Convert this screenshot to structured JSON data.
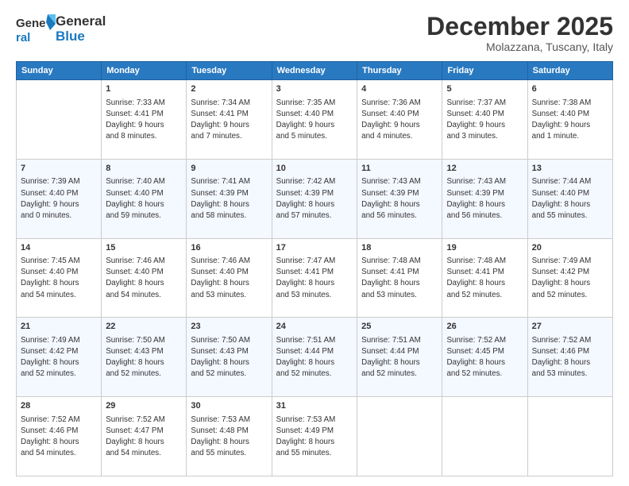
{
  "header": {
    "logo_line1": "General",
    "logo_line2": "Blue",
    "month": "December 2025",
    "location": "Molazzana, Tuscany, Italy"
  },
  "days_of_week": [
    "Sunday",
    "Monday",
    "Tuesday",
    "Wednesday",
    "Thursday",
    "Friday",
    "Saturday"
  ],
  "weeks": [
    [
      {
        "num": "",
        "info": ""
      },
      {
        "num": "1",
        "info": "Sunrise: 7:33 AM\nSunset: 4:41 PM\nDaylight: 9 hours\nand 8 minutes."
      },
      {
        "num": "2",
        "info": "Sunrise: 7:34 AM\nSunset: 4:41 PM\nDaylight: 9 hours\nand 7 minutes."
      },
      {
        "num": "3",
        "info": "Sunrise: 7:35 AM\nSunset: 4:40 PM\nDaylight: 9 hours\nand 5 minutes."
      },
      {
        "num": "4",
        "info": "Sunrise: 7:36 AM\nSunset: 4:40 PM\nDaylight: 9 hours\nand 4 minutes."
      },
      {
        "num": "5",
        "info": "Sunrise: 7:37 AM\nSunset: 4:40 PM\nDaylight: 9 hours\nand 3 minutes."
      },
      {
        "num": "6",
        "info": "Sunrise: 7:38 AM\nSunset: 4:40 PM\nDaylight: 9 hours\nand 1 minute."
      }
    ],
    [
      {
        "num": "7",
        "info": "Sunrise: 7:39 AM\nSunset: 4:40 PM\nDaylight: 9 hours\nand 0 minutes."
      },
      {
        "num": "8",
        "info": "Sunrise: 7:40 AM\nSunset: 4:40 PM\nDaylight: 8 hours\nand 59 minutes."
      },
      {
        "num": "9",
        "info": "Sunrise: 7:41 AM\nSunset: 4:39 PM\nDaylight: 8 hours\nand 58 minutes."
      },
      {
        "num": "10",
        "info": "Sunrise: 7:42 AM\nSunset: 4:39 PM\nDaylight: 8 hours\nand 57 minutes."
      },
      {
        "num": "11",
        "info": "Sunrise: 7:43 AM\nSunset: 4:39 PM\nDaylight: 8 hours\nand 56 minutes."
      },
      {
        "num": "12",
        "info": "Sunrise: 7:43 AM\nSunset: 4:39 PM\nDaylight: 8 hours\nand 56 minutes."
      },
      {
        "num": "13",
        "info": "Sunrise: 7:44 AM\nSunset: 4:40 PM\nDaylight: 8 hours\nand 55 minutes."
      }
    ],
    [
      {
        "num": "14",
        "info": "Sunrise: 7:45 AM\nSunset: 4:40 PM\nDaylight: 8 hours\nand 54 minutes."
      },
      {
        "num": "15",
        "info": "Sunrise: 7:46 AM\nSunset: 4:40 PM\nDaylight: 8 hours\nand 54 minutes."
      },
      {
        "num": "16",
        "info": "Sunrise: 7:46 AM\nSunset: 4:40 PM\nDaylight: 8 hours\nand 53 minutes."
      },
      {
        "num": "17",
        "info": "Sunrise: 7:47 AM\nSunset: 4:41 PM\nDaylight: 8 hours\nand 53 minutes."
      },
      {
        "num": "18",
        "info": "Sunrise: 7:48 AM\nSunset: 4:41 PM\nDaylight: 8 hours\nand 53 minutes."
      },
      {
        "num": "19",
        "info": "Sunrise: 7:48 AM\nSunset: 4:41 PM\nDaylight: 8 hours\nand 52 minutes."
      },
      {
        "num": "20",
        "info": "Sunrise: 7:49 AM\nSunset: 4:42 PM\nDaylight: 8 hours\nand 52 minutes."
      }
    ],
    [
      {
        "num": "21",
        "info": "Sunrise: 7:49 AM\nSunset: 4:42 PM\nDaylight: 8 hours\nand 52 minutes."
      },
      {
        "num": "22",
        "info": "Sunrise: 7:50 AM\nSunset: 4:43 PM\nDaylight: 8 hours\nand 52 minutes."
      },
      {
        "num": "23",
        "info": "Sunrise: 7:50 AM\nSunset: 4:43 PM\nDaylight: 8 hours\nand 52 minutes."
      },
      {
        "num": "24",
        "info": "Sunrise: 7:51 AM\nSunset: 4:44 PM\nDaylight: 8 hours\nand 52 minutes."
      },
      {
        "num": "25",
        "info": "Sunrise: 7:51 AM\nSunset: 4:44 PM\nDaylight: 8 hours\nand 52 minutes."
      },
      {
        "num": "26",
        "info": "Sunrise: 7:52 AM\nSunset: 4:45 PM\nDaylight: 8 hours\nand 52 minutes."
      },
      {
        "num": "27",
        "info": "Sunrise: 7:52 AM\nSunset: 4:46 PM\nDaylight: 8 hours\nand 53 minutes."
      }
    ],
    [
      {
        "num": "28",
        "info": "Sunrise: 7:52 AM\nSunset: 4:46 PM\nDaylight: 8 hours\nand 54 minutes."
      },
      {
        "num": "29",
        "info": "Sunrise: 7:52 AM\nSunset: 4:47 PM\nDaylight: 8 hours\nand 54 minutes."
      },
      {
        "num": "30",
        "info": "Sunrise: 7:53 AM\nSunset: 4:48 PM\nDaylight: 8 hours\nand 55 minutes."
      },
      {
        "num": "31",
        "info": "Sunrise: 7:53 AM\nSunset: 4:49 PM\nDaylight: 8 hours\nand 55 minutes."
      },
      {
        "num": "",
        "info": ""
      },
      {
        "num": "",
        "info": ""
      },
      {
        "num": "",
        "info": ""
      }
    ]
  ]
}
